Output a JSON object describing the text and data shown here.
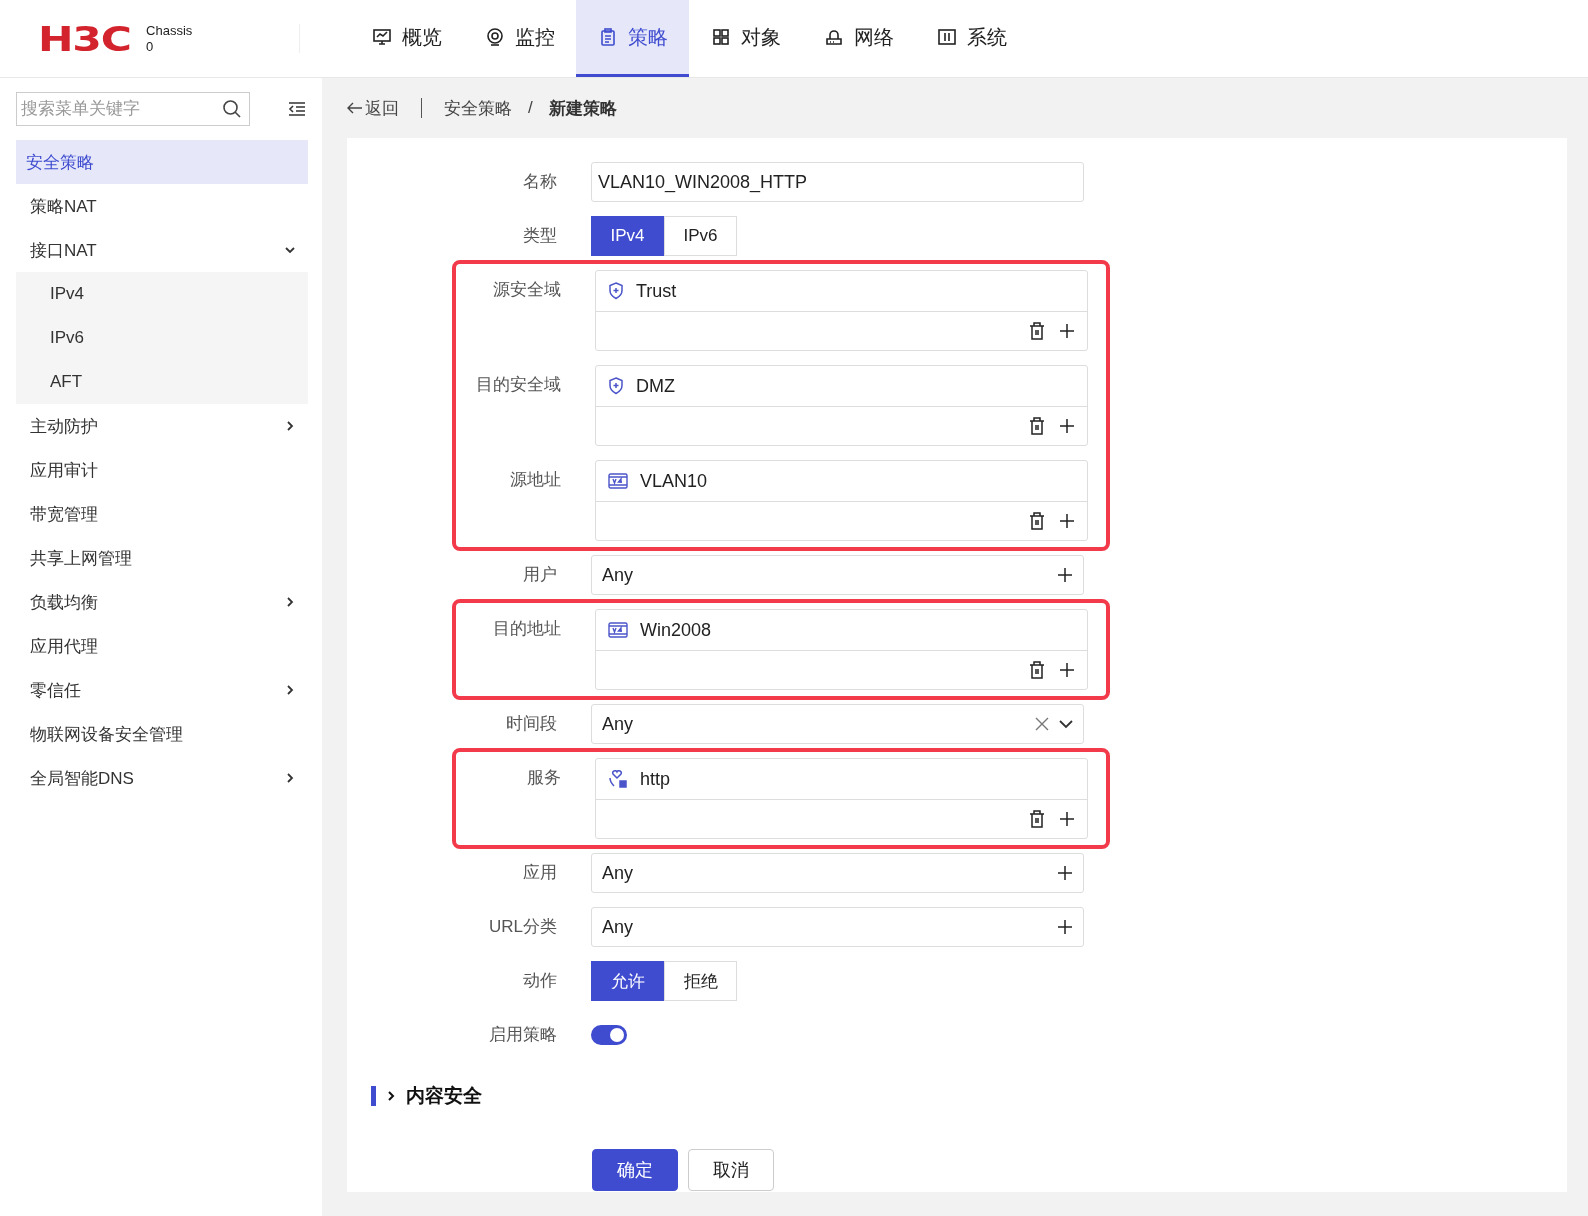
{
  "header": {
    "logo": "H3C",
    "device": "Chassis",
    "device_id": "0"
  },
  "nav": [
    {
      "label": "概览",
      "selected": false
    },
    {
      "label": "监控",
      "selected": false
    },
    {
      "label": "策略",
      "selected": true
    },
    {
      "label": "对象",
      "selected": false
    },
    {
      "label": "网络",
      "selected": false
    },
    {
      "label": "系统",
      "selected": false
    }
  ],
  "sidebar": {
    "search": {
      "placeholder": "搜索菜单关键字"
    },
    "items": [
      {
        "label": "安全策略",
        "selected": true
      },
      {
        "label": "策略NAT",
        "selected": false
      },
      {
        "label": "接口NAT",
        "selected": false,
        "expanded": true,
        "children": [
          {
            "label": "IPv4",
            "selected": false
          },
          {
            "label": "IPv6",
            "selected": false
          },
          {
            "label": "AFT",
            "selected": false
          }
        ]
      },
      {
        "label": "主动防护",
        "selected": false,
        "expanded": false
      },
      {
        "label": "应用审计",
        "selected": false
      },
      {
        "label": "带宽管理",
        "selected": false
      },
      {
        "label": "共享上网管理",
        "selected": false
      },
      {
        "label": "负载均衡",
        "selected": false,
        "expanded": false
      },
      {
        "label": "应用代理",
        "selected": false
      },
      {
        "label": "零信任",
        "selected": false,
        "expanded": false
      },
      {
        "label": "物联网设备安全管理",
        "selected": false
      },
      {
        "label": "全局智能DNS",
        "selected": false,
        "expanded": false
      }
    ]
  },
  "breadcrumb": {
    "back": "返回",
    "path": [
      "安全策略",
      "新建策略"
    ],
    "separator": "/"
  },
  "form": [
    {
      "highlighted": false,
      "rows": [
        {
          "kind": "text",
          "label": "名称",
          "value": "VLAN10_WIN2008_HTTP"
        },
        {
          "kind": "segmented",
          "label": "类型",
          "options": [
            {
              "label": "IPv4",
              "selected": true
            },
            {
              "label": "IPv6",
              "selected": false
            }
          ]
        }
      ]
    },
    {
      "highlighted": true,
      "rows": [
        {
          "kind": "multi",
          "label": "源安全域",
          "items": [
            {
              "kind": "zone",
              "label": "Trust"
            }
          ]
        },
        {
          "kind": "multi",
          "label": "目的安全域",
          "items": [
            {
              "kind": "zone",
              "label": "DMZ"
            }
          ]
        },
        {
          "kind": "multi",
          "label": "源地址",
          "items": [
            {
              "kind": "address",
              "label": "VLAN10"
            }
          ]
        }
      ]
    },
    {
      "highlighted": false,
      "rows": [
        {
          "kind": "add",
          "label": "用户",
          "value": "Any"
        }
      ]
    },
    {
      "highlighted": true,
      "rows": [
        {
          "kind": "multi",
          "label": "目的地址",
          "items": [
            {
              "kind": "address",
              "label": "Win2008"
            }
          ]
        }
      ]
    },
    {
      "highlighted": false,
      "rows": [
        {
          "kind": "select",
          "label": "时间段",
          "value": "Any"
        }
      ]
    },
    {
      "highlighted": true,
      "rows": [
        {
          "kind": "multi",
          "label": "服务",
          "items": [
            {
              "kind": "service",
              "label": "http"
            }
          ]
        }
      ]
    },
    {
      "highlighted": false,
      "rows": [
        {
          "kind": "add",
          "label": "应用",
          "value": "Any"
        },
        {
          "kind": "add",
          "label": "URL分类",
          "value": "Any"
        },
        {
          "kind": "segmented",
          "label": "动作",
          "options": [
            {
              "label": "允许",
              "selected": true
            },
            {
              "label": "拒绝",
              "selected": false
            }
          ]
        },
        {
          "kind": "toggle",
          "label": "启用策略",
          "on": true
        }
      ]
    }
  ],
  "section": {
    "title": "内容安全",
    "expanded": false
  },
  "buttons": [
    {
      "label": "确定",
      "primary": true
    },
    {
      "label": "取消",
      "primary": false
    }
  ]
}
